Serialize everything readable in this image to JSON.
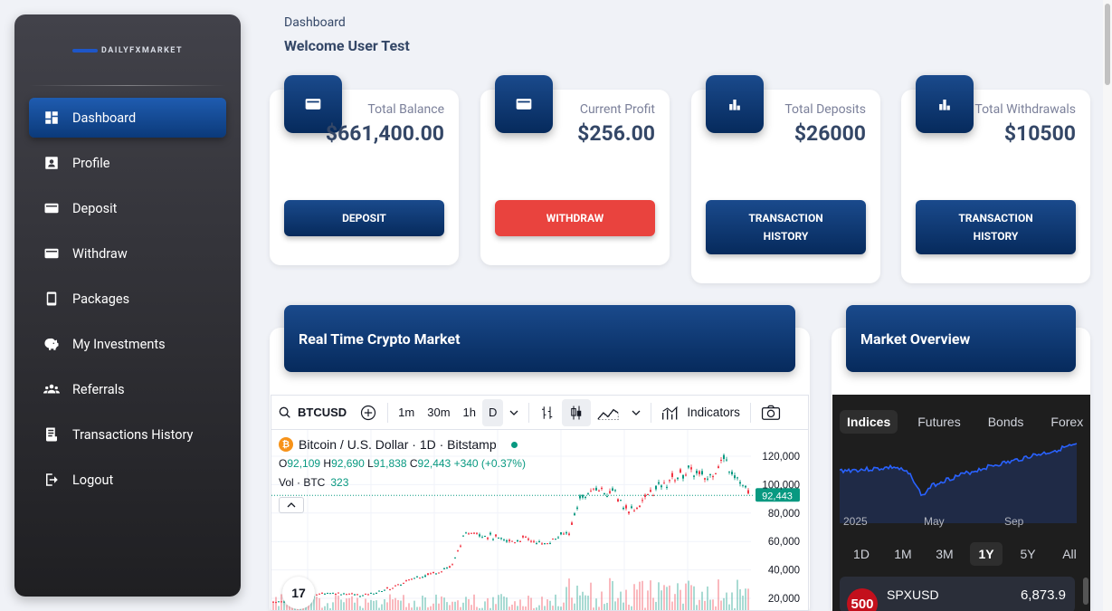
{
  "brand": {
    "name": "DAILYFXMARKET"
  },
  "sidebar": {
    "items": [
      {
        "label": "Dashboard",
        "icon": "dashboard-icon",
        "active": true
      },
      {
        "label": "Profile",
        "icon": "profile-icon"
      },
      {
        "label": "Deposit",
        "icon": "wallet-icon"
      },
      {
        "label": "Withdraw",
        "icon": "wallet-icon"
      },
      {
        "label": "Packages",
        "icon": "phone-icon"
      },
      {
        "label": "My Investments",
        "icon": "piggy-bank-icon"
      },
      {
        "label": "Referrals",
        "icon": "group-icon"
      },
      {
        "label": "Transactions History",
        "icon": "receipt-icon"
      },
      {
        "label": "Logout",
        "icon": "logout-icon"
      }
    ]
  },
  "header": {
    "breadcrumb": "Dashboard",
    "welcome": "Welcome User Test"
  },
  "cards": [
    {
      "label": "Total Balance",
      "value": "$661,400.00",
      "button": "DEPOSIT",
      "icon": "wallet-icon"
    },
    {
      "label": "Current Profit",
      "value": "$256.00",
      "button": "WITHDRAW",
      "icon": "wallet-icon"
    },
    {
      "label": "Total Deposits",
      "value": "$26000",
      "button_line1": "TRANSACTION",
      "button_line2": "HISTORY",
      "icon": "bar-chart-icon"
    },
    {
      "label": "Total Withdrawals",
      "value": "$10500",
      "button_line1": "TRANSACTION",
      "button_line2": "HISTORY",
      "icon": "bar-chart-icon"
    }
  ],
  "crypto_panel": {
    "title": "Real Time Crypto Market",
    "toolbar": {
      "symbol": "BTCUSD",
      "intervals": [
        "1m",
        "30m",
        "1h",
        "D"
      ],
      "indicators": "Indicators"
    },
    "legend": {
      "badge": "₿",
      "title": "Bitcoin / U.S. Dollar · 1D · Bitstamp"
    },
    "ohlc": {
      "o_label": "O",
      "o": "92,109",
      "h_label": "H",
      "h": "92,690",
      "l_label": "L",
      "l": "91,838",
      "c_label": "C",
      "c": "92,443",
      "change": "+340 (+0.37%)"
    },
    "volume": {
      "label": "Vol · BTC",
      "value": "323"
    },
    "price_axis": [
      "120,000",
      "100,000",
      "80,000",
      "60,000",
      "40,000",
      "20,000"
    ],
    "last_price": "92,443",
    "logo": "17"
  },
  "market_panel": {
    "title": "Market Overview",
    "tabs": [
      "Indices",
      "Futures",
      "Bonds",
      "Forex"
    ],
    "time_axis": [
      "2025",
      "May",
      "Sep"
    ],
    "ranges": [
      "1D",
      "1M",
      "3M",
      "1Y",
      "5Y",
      "All"
    ],
    "active_range": "1Y",
    "row": {
      "badge": "500",
      "symbol": "SPXUSD",
      "price": "6,873.9"
    }
  },
  "colors": {
    "primary": "#0b3a7a",
    "danger": "#e9433e",
    "up": "#089981",
    "down": "#f23645"
  }
}
